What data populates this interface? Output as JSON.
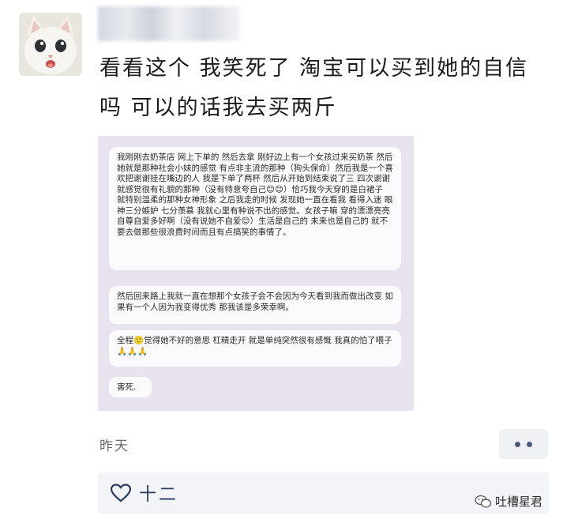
{
  "post": {
    "text": "看看这个 我笑死了 淘宝可以买到她的自信吗 可以的话我去买两斤",
    "time": "昨天",
    "likes": "十二"
  },
  "screenshot": {
    "messages": [
      "我刚刚去奶茶店 网上下单的 然后去拿 刚好边上有一个女孩过来买奶茶 然后她就是那种社会小妹的感觉 有点非主流的那种（狗头保命）然后我是一个喜欢把谢谢挂在嘴边的人 我是下单了两杯 然后从开始到结束说了三 四次谢谢 就感觉很有礼貌的那种（没有特意夸自己😊😊）恰巧我今天穿的是白裙子 就特别温柔的那种女神形象 之后我走的时候 发现她一直在看我 看得入迷 眼神三分嫉妒 七分羡慕 我就心里有种说不出的感觉。女孩子嘛 穿的漂漂亮亮 自尊自爱多好啊（没有说她不自爱😊）生活是自己的 未来也是自己的 就不要去做那些很浪费时间而且有点搞笑的事情了。",
      "然后回来路上我就一直在想那个女孩子会不会因为今天看到我而做出改变 如果有一个人因为我变得优秀 那我该是多荣幸啊。",
      "全程🙂觉得她不好的意思 杠精走开 就是单纯突然很有感慨 我真的怕了喂子🙏🙏🙏",
      "害死."
    ]
  },
  "watermark": {
    "text": "吐槽星君"
  },
  "colors": {
    "more_dots": "#4e5b78",
    "likes_text": "#2b3a5c",
    "bar_bg": "#f3f4f7"
  },
  "icons": {
    "avatar": "cat-avatar",
    "more": "more-dots-icon",
    "like": "heart-icon",
    "watermark": "wechat-icon"
  }
}
